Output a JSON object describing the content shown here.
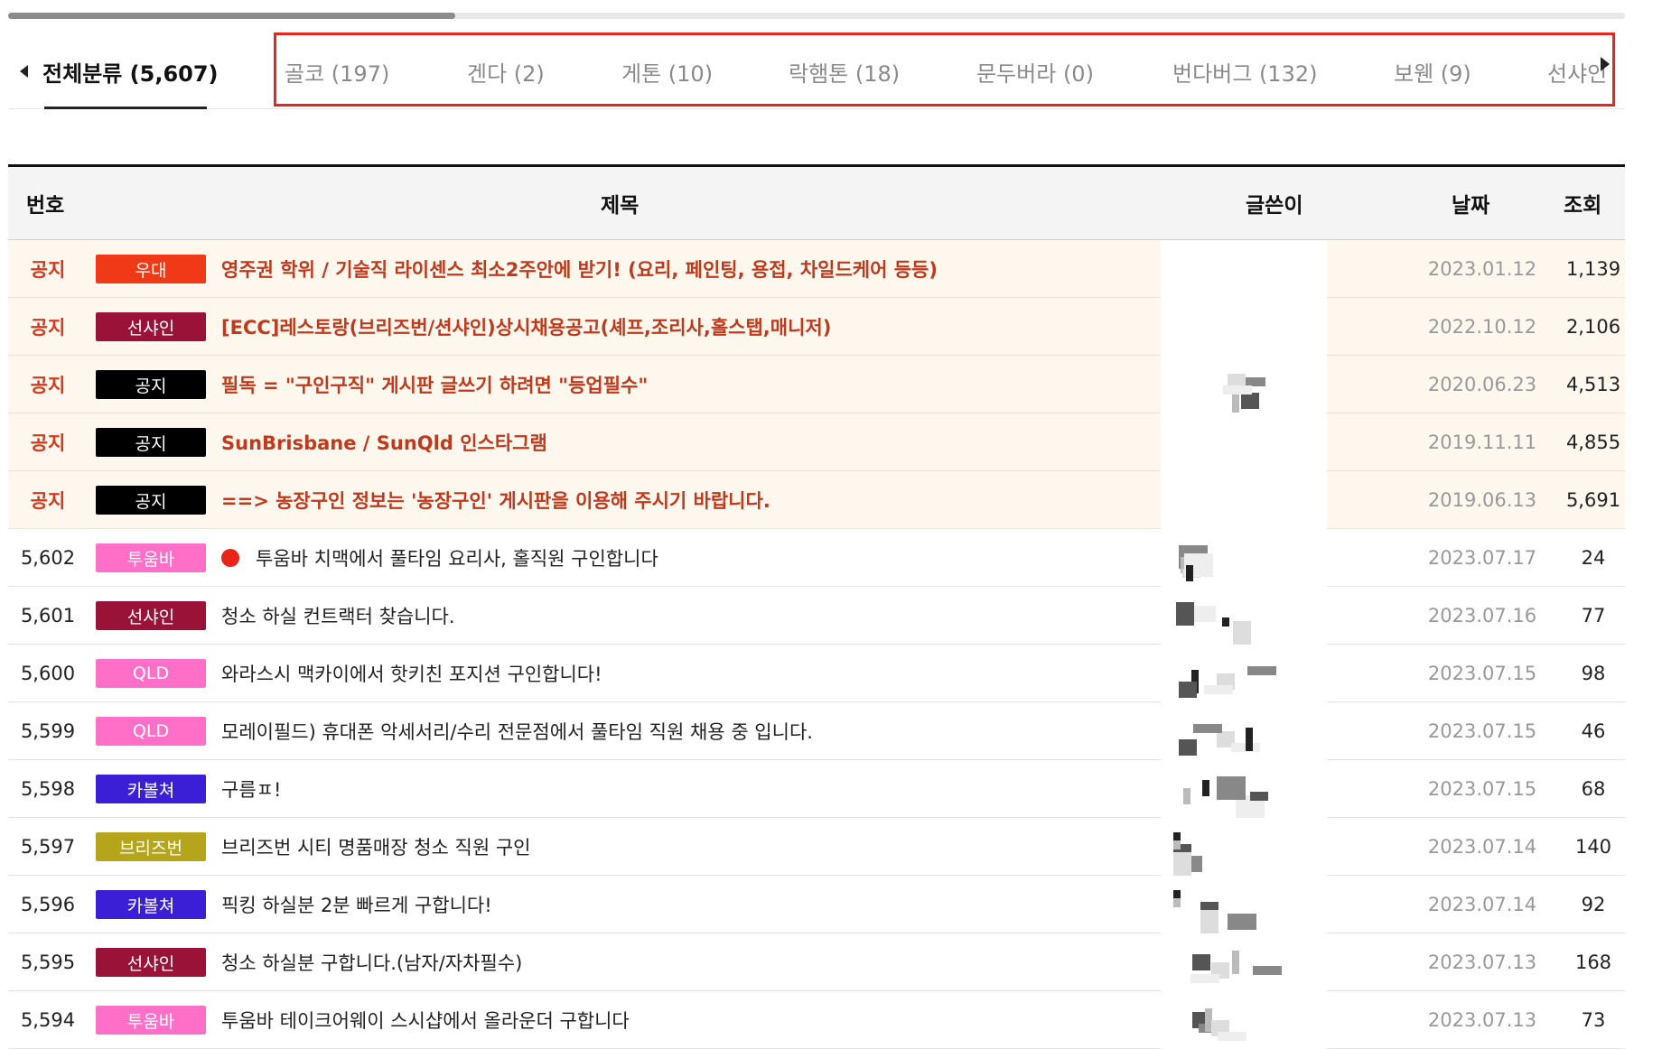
{
  "category_nav": {
    "all_label": "전체분류 (5,607)",
    "tabs": [
      {
        "label": "골코 (197)"
      },
      {
        "label": "겐다 (2)"
      },
      {
        "label": "게톤 (10)"
      },
      {
        "label": "락햄톤 (18)"
      },
      {
        "label": "문두버라 (0)"
      },
      {
        "label": "번다버그 (132)"
      },
      {
        "label": "보웬 (9)"
      },
      {
        "label": "선샤인"
      }
    ]
  },
  "table": {
    "headers": {
      "num": "번호",
      "title": "제목",
      "author": "글쓴이",
      "date": "날짜",
      "views": "조회"
    },
    "rows": [
      {
        "num": "공지",
        "badge": "우대",
        "badge_color": "#f03a17",
        "title": "영주권 학위 / 기술직 라이센스 최소2주안에 받기! (요리, 페인팅, 용접, 차일드케어 등등)",
        "date": "2023.01.12",
        "views": "1,139",
        "notice": true
      },
      {
        "num": "공지",
        "badge": "선샤인",
        "badge_color": "#9b1239",
        "title": "[ECC]레스토랑(브리즈번/션샤인)상시채용공고(셰프,조리사,홀스탭,매니저)",
        "date": "2022.10.12",
        "views": "2,106",
        "notice": true
      },
      {
        "num": "공지",
        "badge": "공지",
        "badge_color": "#000000",
        "title": "필독 = \"구인구직\" 게시판 글쓰기 하려면 \"등업필수\"",
        "date": "2020.06.23",
        "views": "4,513",
        "notice": true
      },
      {
        "num": "공지",
        "badge": "공지",
        "badge_color": "#000000",
        "title": "SunBrisbane / SunQld 인스타그램",
        "date": "2019.11.11",
        "views": "4,855",
        "notice": true
      },
      {
        "num": "공지",
        "badge": "공지",
        "badge_color": "#000000",
        "title": "==> 농장구인 정보는 '농장구인' 게시판을 이용해 주시기 바랍니다.",
        "date": "2019.06.13",
        "views": "5,691",
        "notice": true
      },
      {
        "num": "5,602",
        "badge": "투움바",
        "badge_color": "#ff6fc7",
        "title": "투움바 치맥에서 풀타임 요리사, 홀직원 구인합니다",
        "date": "2023.07.17",
        "views": "24",
        "new": true
      },
      {
        "num": "5,601",
        "badge": "선샤인",
        "badge_color": "#9b1239",
        "title": "청소 하실 컨트랙터 찾습니다.",
        "date": "2023.07.16",
        "views": "77"
      },
      {
        "num": "5,600",
        "badge": "QLD",
        "badge_color": "#ff6fc7",
        "title": "와라스시 맥카이에서 핫키친 포지션 구인합니다!",
        "date": "2023.07.15",
        "views": "98"
      },
      {
        "num": "5,599",
        "badge": "QLD",
        "badge_color": "#ff6fc7",
        "title": "모레이필드) 휴대폰 악세서리/수리 전문점에서 풀타임 직원 채용 중 입니다.",
        "date": "2023.07.15",
        "views": "46"
      },
      {
        "num": "5,598",
        "badge": "카볼쳐",
        "badge_color": "#3a1fd6",
        "title": "구름ㅍ!",
        "date": "2023.07.15",
        "views": "68"
      },
      {
        "num": "5,597",
        "badge": "브리즈번",
        "badge_color": "#b5a51b",
        "title": "브리즈번 시티 명품매장 청소 직원 구인",
        "date": "2023.07.14",
        "views": "140"
      },
      {
        "num": "5,596",
        "badge": "카볼쳐",
        "badge_color": "#3a1fd6",
        "title": "픽킹 하실분 2분 빠르게 구합니다!",
        "date": "2023.07.14",
        "views": "92"
      },
      {
        "num": "5,595",
        "badge": "선샤인",
        "badge_color": "#9b1239",
        "title": "청소 하실분 구합니다.(남자/자차필수)",
        "date": "2023.07.13",
        "views": "168"
      },
      {
        "num": "5,594",
        "badge": "투움바",
        "badge_color": "#ff6fc7",
        "title": "투움바 테이크어웨이 스시샵에서 올라운더 구합니다",
        "date": "2023.07.13",
        "views": "73"
      }
    ]
  }
}
